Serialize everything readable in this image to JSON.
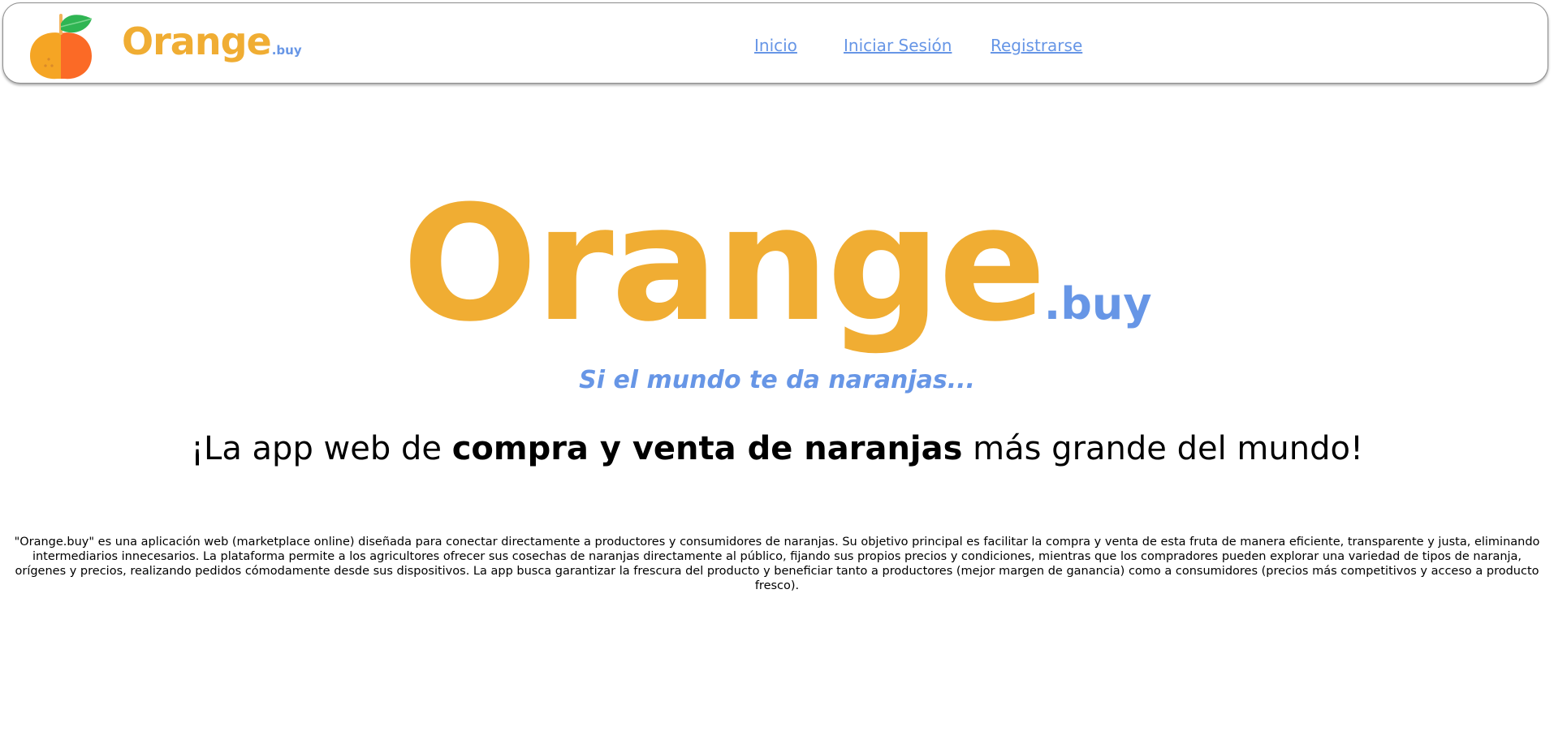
{
  "header": {
    "brand": {
      "main": "Orange",
      "suffix": ".buy"
    },
    "logo_icon": "orange-fruit-icon",
    "nav": [
      {
        "label": "Inicio"
      },
      {
        "label": "Iniciar Sesión"
      },
      {
        "label": "Registrarse"
      }
    ]
  },
  "hero": {
    "brand": {
      "main": "Orange",
      "suffix": ".buy"
    },
    "slogan": "Si el mundo te da naranjas...",
    "tagline": {
      "before": "¡La app web de ",
      "bold": "compra y venta de naranjas",
      "after": " más grande del mundo!"
    },
    "description": "\"Orange.buy\" es una aplicación web (marketplace online) diseñada para conectar directamente a productores y consumidores de naranjas. Su objetivo principal es facilitar la compra y venta de esta fruta de manera eficiente, transparente y justa, eliminando intermediarios innecesarios. La plataforma permite a los agricultores ofrecer sus cosechas de naranjas directamente al público, fijando sus propios precios y condiciones, mientras que los compradores pueden explorar una variedad de tipos de naranja, orígenes y precios, realizando pedidos cómodamente desde sus dispositivos. La app busca garantizar la frescura del producto y beneficiar tanto a productores (mejor margen de ganancia) como a consumidores (precios más competitivos y acceso a producto fresco)."
  },
  "colors": {
    "brand_orange": "#f0ad33",
    "accent_blue": "#6796e6",
    "fruit_left": "#f5a524",
    "fruit_right": "#fb6a26",
    "leaf": "#2fb553"
  }
}
